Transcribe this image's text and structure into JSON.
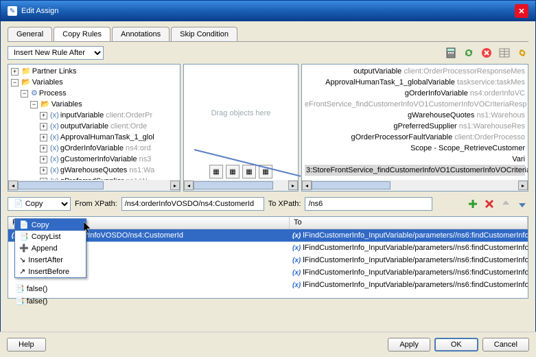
{
  "title": "Edit Assign",
  "tabs": [
    "General",
    "Copy Rules",
    "Annotations",
    "Skip Condition"
  ],
  "active_tab": 1,
  "insert_rule": "Insert New Rule After",
  "left_tree": {
    "partner_links": "Partner Links",
    "variables": "Variables",
    "process": "Process",
    "process_vars": "Variables",
    "items": [
      {
        "name": "inputVariable",
        "type": "client:OrderPr"
      },
      {
        "name": "outputVariable",
        "type": "client:Orde"
      },
      {
        "name": "ApprovalHumanTask_1_glol",
        "type": ""
      },
      {
        "name": "gOrderInfoVariable",
        "type": "ns4:ord"
      },
      {
        "name": "gCustomerInfoVariable",
        "type": "ns3"
      },
      {
        "name": "gWarehouseQuotes",
        "type": "ns1:Wa"
      },
      {
        "name": "gPreferredSupplier",
        "type": "ns1:W"
      }
    ]
  },
  "drag_hint": "Drag objects here",
  "right_tree": {
    "lines": [
      {
        "name": "outputVariable",
        "type": "client:OrderProcessorResponseMes"
      },
      {
        "name": "ApprovalHumanTask_1_globalVariable",
        "type": "taskservice:taskMes"
      },
      {
        "name": "gOrderInfoVariable",
        "type": "ns4:orderInfoVC"
      },
      {
        "name": "eFrontService_findCustomerInfoVO1CustomerInfoVOCriteriaResp",
        "type": "",
        "allgray": true
      },
      {
        "name": "gWarehouseQuotes",
        "type": "ns1:Warehous"
      },
      {
        "name": "gPreferredSupplier",
        "type": "ns1:WarehouseRes"
      },
      {
        "name": "gOrderProcessorFaultVariable",
        "type": "client:OrderProcesso"
      },
      {
        "name": "Scope - Scope_RetrieveCustomer",
        "type": ""
      },
      {
        "name": "Vari",
        "type": ""
      }
    ],
    "highlight": "3:StoreFrontService_findCustomerInfoVO1CustomerInfoVOCriteria"
  },
  "operation_dd": "Copy",
  "from_xpath_label": "From XPath:",
  "from_xpath": "/ns4:orderInfoVOSDO/ns4:CustomerId",
  "to_xpath_label": "To XPath:",
  "to_xpath": "/ns6",
  "grid_headers": {
    "from": "From",
    "to": "To"
  },
  "grid_rows": [
    {
      "from": "Variable///ns4:orderInfoVOSDO/ns4:CustomerId",
      "to": "lFindCustomerInfo_InputVariable/parameters//ns6:findCustomerInfo…",
      "selected": true
    },
    {
      "from": "",
      "to": "lFindCustomerInfo_InputVariable/parameters//ns6:findCustomerInfo…"
    },
    {
      "from": "",
      "to": "lFindCustomerInfo_InputVariable/parameters//ns6:findCustomerInfo…"
    },
    {
      "from": "",
      "to": "lFindCustomerInfo_InputVariable/parameters//ns6:findCustomerInfo…"
    },
    {
      "from": "",
      "to": "lFindCustomerInfo_InputVariable/parameters//ns6:findCustomerInfo…"
    }
  ],
  "menu_items": [
    "Copy",
    "CopyList",
    "Append",
    "InsertAfter",
    "InsertBefore"
  ],
  "false_items": [
    "false()",
    "false()"
  ],
  "buttons": {
    "help": "Help",
    "apply": "Apply",
    "ok": "OK",
    "cancel": "Cancel"
  }
}
